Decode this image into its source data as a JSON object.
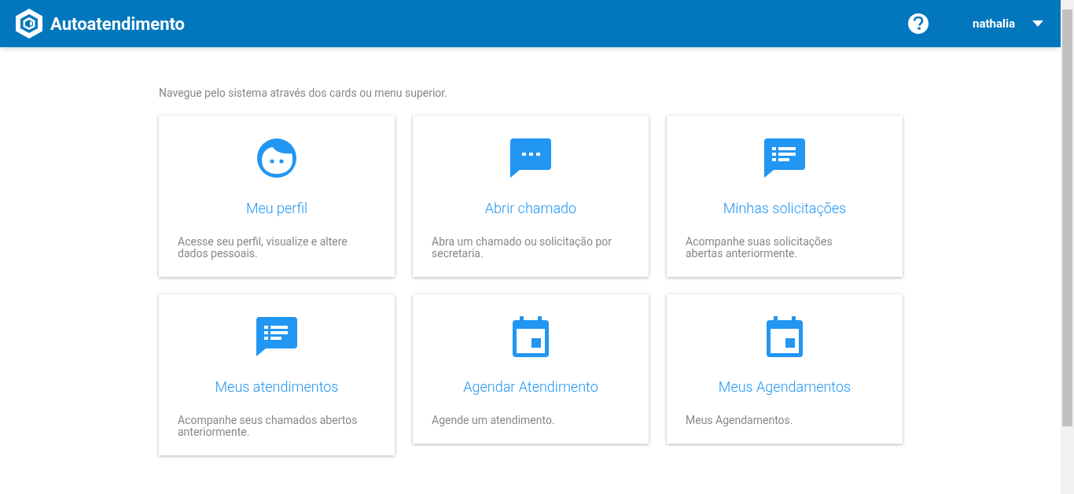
{
  "header": {
    "title": "Autoatendimento",
    "user": "nathalia"
  },
  "intro": "Navegue pelo sistema através dos cards ou menu superior.",
  "cards": [
    {
      "kind": "face",
      "title": "Meu perfil",
      "description": "Acesse seu perfil, visualize e altere dados pessoais."
    },
    {
      "kind": "chat",
      "title": "Abrir chamado",
      "description": "Abra um chamado ou solicitação por secretaria."
    },
    {
      "kind": "list",
      "title": "Minhas solicitações",
      "description": "Acompanhe suas solicitações abertas anteriormente."
    },
    {
      "kind": "list",
      "title": "Meus atendimentos",
      "description": "Acompanhe seus chamados abertos anteriormente."
    },
    {
      "kind": "calendar",
      "title": "Agendar Atendimento",
      "description": "Agende um atendimento."
    },
    {
      "kind": "calendar",
      "title": "Meus Agendamentos",
      "description": "Meus Agendamentos."
    }
  ]
}
